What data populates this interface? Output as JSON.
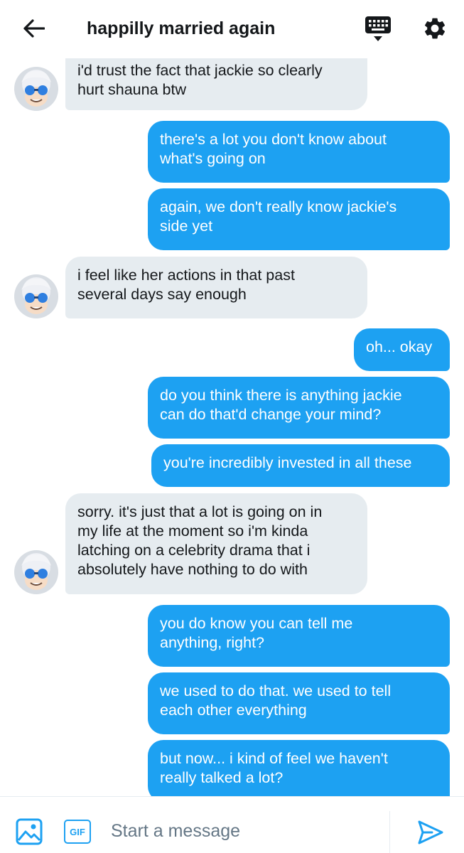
{
  "header": {
    "title": "happilly married again",
    "back_icon": "arrow-left-icon",
    "keyboard_icon": "keyboard-icon",
    "settings_icon": "gear-icon"
  },
  "messages": [
    {
      "direction": "in",
      "text": "i'd trust the fact that jackie so clearly\nhurt shauna btw"
    },
    {
      "direction": "out",
      "text": "there's a lot you don't know about\nwhat's going on"
    },
    {
      "direction": "out",
      "text": "again, we don't really know jackie's\nside yet"
    },
    {
      "direction": "in",
      "text": "i feel like her actions in that past\nseveral days say enough"
    },
    {
      "direction": "out",
      "text": "oh... okay"
    },
    {
      "direction": "out",
      "text": "do you think there is anything jackie\ncan do that'd change your mind?"
    },
    {
      "direction": "out",
      "text": "you're incredibly invested in all these"
    },
    {
      "direction": "in",
      "text": "sorry. it's just that a lot is going on in\nmy life at the moment so i'm kinda\nlatching on a celebrity drama that i\nabsolutely have nothing to do with"
    },
    {
      "direction": "out",
      "text": "you do know you can tell me\nanything, right?"
    },
    {
      "direction": "out",
      "text": "we used to do that. we used to tell\neach other everything"
    },
    {
      "direction": "out",
      "text": "but now... i kind of feel we haven't\nreally talked a lot?"
    }
  ],
  "composer": {
    "gif_label": "GIF",
    "placeholder": "Start a message",
    "media_icon": "image-icon",
    "send_icon": "send-icon"
  },
  "colors": {
    "accent": "#1da1f2",
    "incoming_bubble": "#e6ecf0",
    "text": "#14171a",
    "placeholder": "#657786"
  }
}
